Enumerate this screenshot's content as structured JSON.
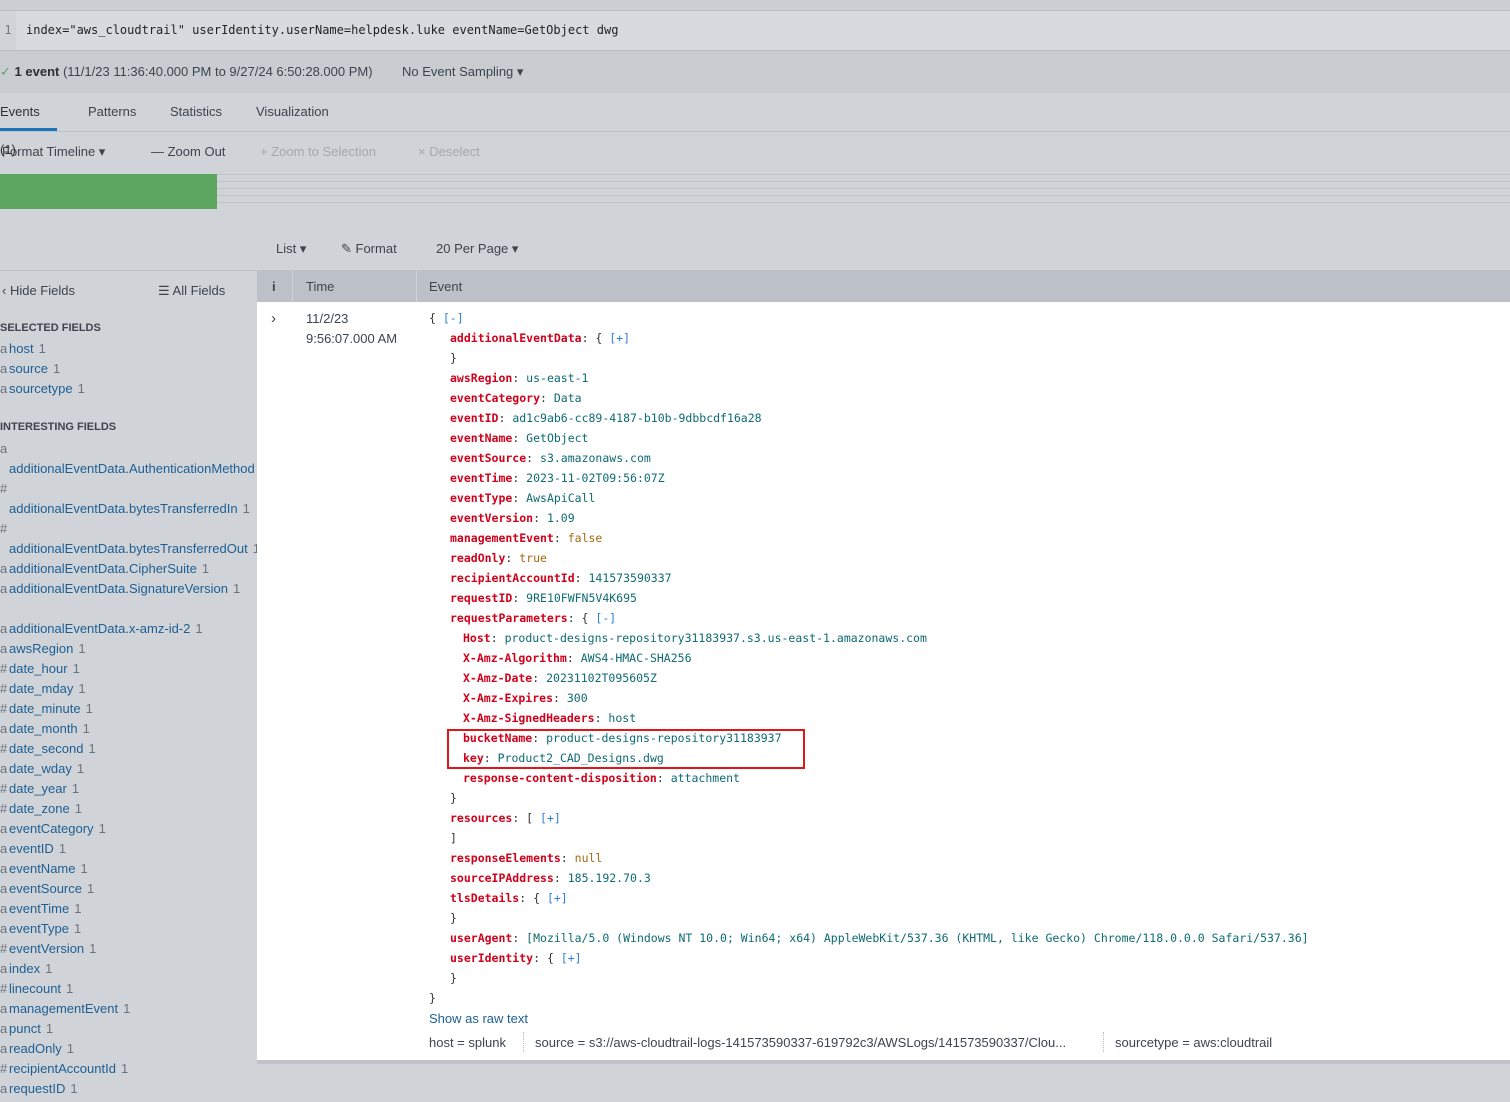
{
  "search": {
    "line_number": "1",
    "query": "index=\"aws_cloudtrail\" userIdentity.userName=helpdesk.luke eventName=GetObject dwg"
  },
  "status": {
    "check": "✓",
    "count": "1 event",
    "range": "(11/1/23 11:36:40.000 PM to 9/27/24 6:50:28.000 PM)",
    "sampling": "No Event Sampling ▾"
  },
  "tabs": [
    {
      "label": "Events (1)",
      "active": true
    },
    {
      "label": "Patterns"
    },
    {
      "label": "Statistics"
    },
    {
      "label": "Visualization"
    }
  ],
  "timeline_toolbar": {
    "format": "Format Timeline ▾",
    "zoom_out": "— Zoom Out",
    "zoom_selection": "+ Zoom to Selection",
    "deselect": "× Deselect"
  },
  "timeline": {
    "bar_color": "#5ca65f",
    "fill_fraction": 1
  },
  "list_toolbar": {
    "list": "List ▾",
    "format": "✎ Format",
    "per_page": "20 Per Page ▾"
  },
  "sidebar": {
    "hide": "‹ Hide Fields",
    "all": "☰ All Fields",
    "selected_title": "SELECTED FIELDS",
    "interesting_title": "INTERESTING FIELDS",
    "selected": [
      {
        "t": "a",
        "name": "host",
        "count": "1"
      },
      {
        "t": "a",
        "name": "source",
        "count": "1"
      },
      {
        "t": "a",
        "name": "sourcetype",
        "count": "1"
      }
    ],
    "interesting": [
      {
        "t": "a",
        "name": "additionalEventData.AuthenticationMethod",
        "count": "1"
      },
      {
        "t": "#",
        "name": "additionalEventData.bytesTransferredIn",
        "count": "1"
      },
      {
        "t": "#",
        "name": "additionalEventData.bytesTransferredOut",
        "count": "1"
      },
      {
        "t": "a",
        "name": "additionalEventData.CipherSuite",
        "count": "1"
      },
      {
        "t": "a",
        "name": "additionalEventData.SignatureVersion",
        "count": "1"
      },
      {
        "t": "a",
        "name": "additionalEventData.x-amz-id-2",
        "count": "1"
      },
      {
        "t": "a",
        "name": "awsRegion",
        "count": "1"
      },
      {
        "t": "#",
        "name": "date_hour",
        "count": "1"
      },
      {
        "t": "#",
        "name": "date_mday",
        "count": "1"
      },
      {
        "t": "#",
        "name": "date_minute",
        "count": "1"
      },
      {
        "t": "a",
        "name": "date_month",
        "count": "1"
      },
      {
        "t": "#",
        "name": "date_second",
        "count": "1"
      },
      {
        "t": "a",
        "name": "date_wday",
        "count": "1"
      },
      {
        "t": "#",
        "name": "date_year",
        "count": "1"
      },
      {
        "t": "#",
        "name": "date_zone",
        "count": "1"
      },
      {
        "t": "a",
        "name": "eventCategory",
        "count": "1"
      },
      {
        "t": "a",
        "name": "eventID",
        "count": "1"
      },
      {
        "t": "a",
        "name": "eventName",
        "count": "1"
      },
      {
        "t": "a",
        "name": "eventSource",
        "count": "1"
      },
      {
        "t": "a",
        "name": "eventTime",
        "count": "1"
      },
      {
        "t": "a",
        "name": "eventType",
        "count": "1"
      },
      {
        "t": "#",
        "name": "eventVersion",
        "count": "1"
      },
      {
        "t": "a",
        "name": "index",
        "count": "1"
      },
      {
        "t": "#",
        "name": "linecount",
        "count": "1"
      },
      {
        "t": "a",
        "name": "managementEvent",
        "count": "1"
      },
      {
        "t": "a",
        "name": "punct",
        "count": "1"
      },
      {
        "t": "a",
        "name": "readOnly",
        "count": "1"
      },
      {
        "t": "#",
        "name": "recipientAccountId",
        "count": "1"
      },
      {
        "t": "a",
        "name": "requestID",
        "count": "1"
      }
    ]
  },
  "table": {
    "col_i": "i",
    "col_time": "Time",
    "col_event": "Event",
    "expand": "›",
    "time_date": "11/2/23",
    "time_clock": "9:56:07.000 AM"
  },
  "event_lines": [
    {
      "i": 0,
      "pre": "{ ",
      "tg": "[-]"
    },
    {
      "i": 1,
      "k": "additionalEventData",
      "pre": ": { ",
      "tg": "[+]"
    },
    {
      "i": 1,
      "pre": "}"
    },
    {
      "i": 1,
      "k": "awsRegion",
      "v": "us-east-1"
    },
    {
      "i": 1,
      "k": "eventCategory",
      "v": "Data"
    },
    {
      "i": 1,
      "k": "eventID",
      "v": "ad1c9ab6-cc89-4187-b10b-9dbbcdf16a28"
    },
    {
      "i": 1,
      "k": "eventName",
      "v": "GetObject"
    },
    {
      "i": 1,
      "k": "eventSource",
      "v": "s3.amazonaws.com"
    },
    {
      "i": 1,
      "k": "eventTime",
      "v": "2023-11-02T09:56:07Z"
    },
    {
      "i": 1,
      "k": "eventType",
      "v": "AwsApiCall"
    },
    {
      "i": 1,
      "k": "eventVersion",
      "v": "1.09"
    },
    {
      "i": 1,
      "k": "managementEvent",
      "b": "false"
    },
    {
      "i": 1,
      "k": "readOnly",
      "b": "true"
    },
    {
      "i": 1,
      "k": "recipientAccountId",
      "v": "141573590337"
    },
    {
      "i": 1,
      "k": "requestID",
      "v": "9RE10FWFN5V4K695"
    },
    {
      "i": 1,
      "k": "requestParameters",
      "pre": ": { ",
      "tg": "[-]"
    },
    {
      "i": 2,
      "k": "Host",
      "v": "product-designs-repository31183937.s3.us-east-1.amazonaws.com"
    },
    {
      "i": 2,
      "k": "X-Amz-Algorithm",
      "v": "AWS4-HMAC-SHA256"
    },
    {
      "i": 2,
      "k": "X-Amz-Date",
      "v": "20231102T095605Z"
    },
    {
      "i": 2,
      "k": "X-Amz-Expires",
      "v": "300"
    },
    {
      "i": 2,
      "k": "X-Amz-SignedHeaders",
      "v": "host"
    },
    {
      "i": 2,
      "k": "bucketName",
      "v": "product-designs-repository31183937"
    },
    {
      "i": 2,
      "k": "key",
      "v": "Product2_CAD_Designs.dwg"
    },
    {
      "i": 2,
      "k": "response-content-disposition",
      "v": "attachment"
    },
    {
      "i": 1,
      "pre": "}"
    },
    {
      "i": 1,
      "k": "resources",
      "pre": ": [ ",
      "tg": "[+]"
    },
    {
      "i": 1,
      "pre": "]"
    },
    {
      "i": 1,
      "k": "responseElements",
      "b": "null"
    },
    {
      "i": 1,
      "k": "sourceIPAddress",
      "v": "185.192.70.3"
    },
    {
      "i": 1,
      "k": "tlsDetails",
      "pre": ": { ",
      "tg": "[+]"
    },
    {
      "i": 1,
      "pre": "}"
    },
    {
      "i": 1,
      "k": "userAgent",
      "v": "[Mozilla/5.0 (Windows NT 10.0; Win64; x64) AppleWebKit/537.36 (KHTML, like Gecko) Chrome/118.0.0.0 Safari/537.36]"
    },
    {
      "i": 1,
      "k": "userIdentity",
      "pre": ": { ",
      "tg": "[+]"
    },
    {
      "i": 1,
      "pre": "}"
    },
    {
      "i": 0,
      "pre": "}"
    }
  ],
  "show_raw": "Show as raw text",
  "meta": [
    {
      "k": "host =",
      "v": "splunk"
    },
    {
      "k": "source =",
      "v": "s3://aws-cloudtrail-logs-141573590337-619792c3/AWSLogs/141573590337/Clou..."
    },
    {
      "k": "sourcetype =",
      "v": "aws:cloudtrail"
    }
  ],
  "colors": {
    "key": "#d0021b",
    "value": "#0e6a73",
    "boolean": "#a36a10",
    "toggle": "#2c7ee0",
    "highlight_box": "#e0161b",
    "tab_active": "#1a74b8"
  }
}
